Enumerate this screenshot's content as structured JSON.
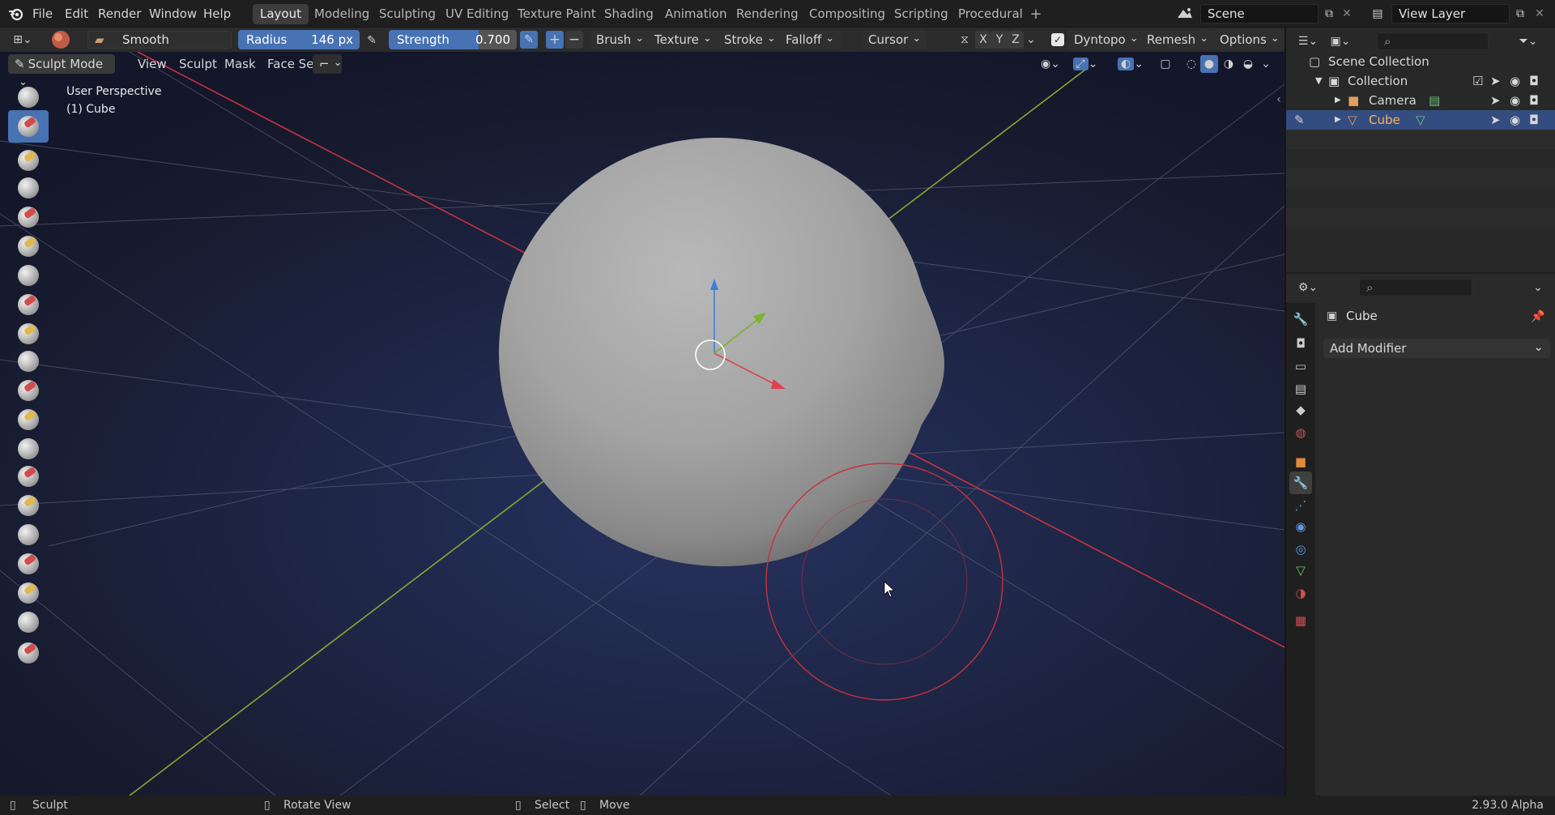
{
  "menu": {
    "file": "File",
    "edit": "Edit",
    "render": "Render",
    "window": "Window",
    "help": "Help"
  },
  "workspaces": [
    "Layout",
    "Modeling",
    "Sculpting",
    "UV Editing",
    "Texture Paint",
    "Shading",
    "Animation",
    "Rendering",
    "Compositing",
    "Scripting",
    "Procedural"
  ],
  "active_workspace": "Layout",
  "scene": {
    "name": "Scene"
  },
  "view_layer": {
    "name": "View Layer"
  },
  "tool_header": {
    "brush_name": "Smooth",
    "radius_label": "Radius",
    "radius_value": "146 px",
    "strength_label": "Strength",
    "strength_value": "0.700",
    "strength_fraction": 0.7,
    "plus": "+",
    "minus": "−",
    "brush": "Brush",
    "texture": "Texture",
    "stroke": "Stroke",
    "falloff": "Falloff",
    "cursor": "Cursor",
    "x": "X",
    "y": "Y",
    "z": "Z",
    "dyntopo": "Dyntopo",
    "remesh": "Remesh",
    "options": "Options"
  },
  "viewport_header": {
    "mode": "Sculpt Mode",
    "view": "View",
    "sculpt": "Sculpt",
    "mask": "Mask",
    "face_sets": "Face Sets"
  },
  "viewport": {
    "perspective": "User Perspective",
    "object": "(1) Cube"
  },
  "outliner": {
    "scene_collection": "Scene Collection",
    "collection": "Collection",
    "items": [
      {
        "name": "Camera",
        "selected": false
      },
      {
        "name": "Cube",
        "selected": true
      }
    ]
  },
  "properties": {
    "object_name": "Cube",
    "add_modifier": "Add Modifier"
  },
  "status_bar": {
    "left": "Sculpt",
    "middle": "Rotate View",
    "select": "Select",
    "move": "Move",
    "version": "2.93.0 Alpha"
  },
  "colors": {
    "accent": "#4772b3",
    "x_axis": "#d0354a",
    "y_axis": "#7fa32a",
    "brush_circle": "#c8303c"
  }
}
